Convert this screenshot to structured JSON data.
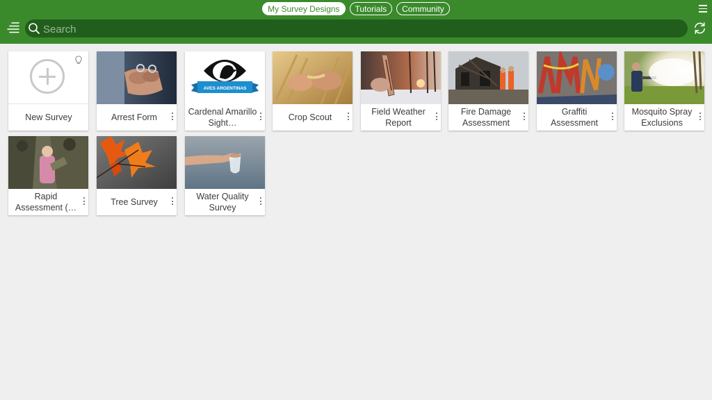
{
  "header": {
    "tabs": [
      {
        "label": "My Survey Designs",
        "active": true
      },
      {
        "label": "Tutorials",
        "active": false
      },
      {
        "label": "Community",
        "active": false
      }
    ],
    "menu_icon": "hamburger-icon",
    "side_menu_icon": "sidebar-menu-icon",
    "refresh_icon": "refresh-icon"
  },
  "search": {
    "placeholder": "Search",
    "value": "",
    "icon": "search-icon"
  },
  "cards": {
    "new_survey": {
      "label": "New Survey",
      "icon": "plus-circle-icon",
      "tip_icon": "lightbulb-icon"
    },
    "items": [
      {
        "title": "Arrest Form",
        "thumbnail": "handcuffs-photo"
      },
      {
        "title": "Cardenal Amarillo Sight…",
        "thumbnail": "aves-argentinas-logo",
        "logo_text": "AVES ARGENTINAS"
      },
      {
        "title": "Crop Scout",
        "thumbnail": "wheat-photo"
      },
      {
        "title": "Field Weather Report",
        "thumbnail": "thermometer-photo"
      },
      {
        "title": "Fire Damage Assessment",
        "thumbnail": "burned-house-photo"
      },
      {
        "title": "Graffiti Assessment",
        "thumbnail": "graffiti-wall-photo"
      },
      {
        "title": "Mosquito Spray Exclusions",
        "thumbnail": "fogging-photo"
      },
      {
        "title": "Rapid Assessment (…",
        "thumbnail": "soldiers-child-photo"
      },
      {
        "title": "Tree Survey",
        "thumbnail": "autumn-leaves-photo"
      },
      {
        "title": "Water Quality Survey",
        "thumbnail": "water-sample-photo"
      }
    ]
  },
  "colors": {
    "header_green": "#3a8a2c",
    "search_green": "#215e1b",
    "background": "#efefef",
    "aves_blue": "#1e8fce"
  }
}
